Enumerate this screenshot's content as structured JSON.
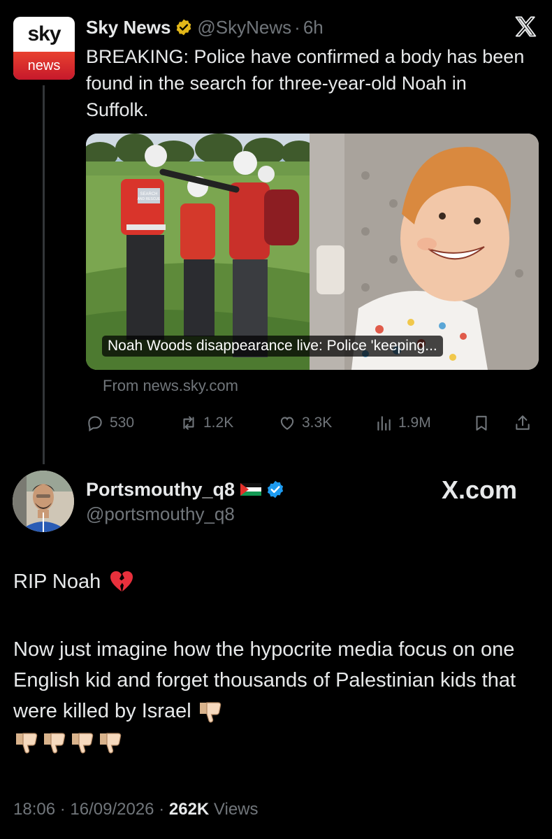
{
  "quoted_tweet": {
    "logo_top": "sky",
    "logo_bottom": "news",
    "author_name": "Sky News",
    "author_handle": "@SkyNews",
    "separator": "·",
    "time_ago": "6h",
    "text": "BREAKING: Police have confirmed a body has been found in the search for three-year-old Noah in Suffolk.",
    "card": {
      "title": "Noah Woods disappearance live: Police 'keeping...",
      "source": "From news.sky.com",
      "vest_text_line1": "SEARCH",
      "vest_text_line2": "AND RESCUE"
    },
    "actions": {
      "replies": "530",
      "reposts": "1.2K",
      "likes": "3.3K",
      "views": "1.9M"
    }
  },
  "main_tweet": {
    "author_name": "Portsmouthy_q8",
    "author_handle": "@portsmouthy_q8",
    "site_label": "X.com",
    "text_line1": "RIP Noah",
    "text_para2": "Now just imagine how the hypocrite media focus on one English kid and forget thousands of Palestinian kids that were killed by Israel",
    "time": "18:06",
    "date": "16/09/2026",
    "separator": "·",
    "views_count": "262K",
    "views_label": "Views"
  },
  "icons": [
    "gold-verified-badge",
    "x-logo",
    "reply-icon",
    "repost-icon",
    "like-icon",
    "views-icon",
    "bookmark-icon",
    "share-icon",
    "blue-verified-badge",
    "palestine-flag",
    "broken-heart-emoji",
    "thumbs-down-emoji"
  ],
  "colors": {
    "background": "#000000",
    "text": "#e7e9ea",
    "muted": "#71767b",
    "verified_blue": "#1d9bf0",
    "verified_gold": "#e2b719"
  }
}
